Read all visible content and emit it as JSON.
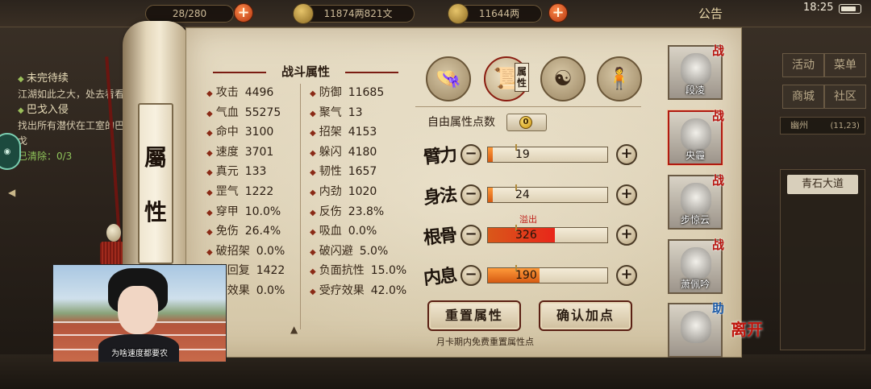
{
  "topbar": {
    "resource1": "28/280",
    "resource2": "11874两821文",
    "resource3": "11644两",
    "notice": "公告",
    "time": "18:25"
  },
  "quest": {
    "items": [
      {
        "title": "未完待续",
        "desc": "江湖如此之大，处去看看"
      },
      {
        "title": "巴戈入侵",
        "desc": "找出所有潜伏在工室的巴戈",
        "progress": "已清除：0/3"
      }
    ]
  },
  "right_menu": {
    "buttons": [
      "活动",
      "菜单",
      "商城",
      "社区"
    ],
    "region": "幽州",
    "region_coords": "(11,23)",
    "location": "青石大道"
  },
  "scroll": {
    "label_top": "屬",
    "label_bottom": "性"
  },
  "stats": {
    "title": "战斗属性",
    "left": [
      {
        "k": "攻击",
        "v": "4496"
      },
      {
        "k": "气血",
        "v": "55275"
      },
      {
        "k": "命中",
        "v": "3100"
      },
      {
        "k": "速度",
        "v": "3701"
      },
      {
        "k": "真元",
        "v": "133"
      },
      {
        "k": "罡气",
        "v": "1222"
      },
      {
        "k": "穿甲",
        "v": "10.0%"
      },
      {
        "k": "免伤",
        "v": "26.4%"
      },
      {
        "k": "破招架",
        "v": "0.0%"
      },
      {
        "k": "血回复",
        "v": "1422"
      },
      {
        "k": "疗效果",
        "v": "0.0%"
      }
    ],
    "right": [
      {
        "k": "防御",
        "v": "11685"
      },
      {
        "k": "聚气",
        "v": "13"
      },
      {
        "k": "招架",
        "v": "4153"
      },
      {
        "k": "躲闪",
        "v": "4180"
      },
      {
        "k": "韧性",
        "v": "1657"
      },
      {
        "k": "内劲",
        "v": "1020"
      },
      {
        "k": "反伤",
        "v": "23.8%"
      },
      {
        "k": "吸血",
        "v": "0.0%"
      },
      {
        "k": "破闪避",
        "v": "5.0%"
      },
      {
        "k": "负面抗性",
        "v": "15.0%"
      },
      {
        "k": "受疗效果",
        "v": "42.0%"
      }
    ]
  },
  "allocation": {
    "tab_label": "属性",
    "free_points_label": "自由属性点数",
    "free_points_value": "0",
    "minus": "−",
    "plus": "+",
    "overflow_label": "溢出",
    "attributes": [
      {
        "name": "臂力",
        "value": "19",
        "fill": 0.02,
        "over": false
      },
      {
        "name": "身法",
        "value": "24",
        "fill": 0.03,
        "over": false
      },
      {
        "name": "根骨",
        "value": "326",
        "fill": 0.56,
        "over": true
      },
      {
        "name": "内息",
        "value": "190",
        "fill": 0.43,
        "over": false
      }
    ],
    "reset_button": "重置属性",
    "confirm_button": "确认加点",
    "footnote": "月卡期内免费重置属性点"
  },
  "party": [
    {
      "name": "段凌",
      "role": "战"
    },
    {
      "name": "央霾",
      "role": "战"
    },
    {
      "name": "步惊云",
      "role": "战"
    },
    {
      "name": "萧佩吟",
      "role": "战"
    },
    {
      "name": "",
      "role": "助"
    }
  ],
  "leave_label": "离开",
  "video": {
    "caption": "为啥速度都要农"
  },
  "colors": {
    "accent_red": "#b8140e",
    "bar_orange": "#e8731f",
    "paper": "#ddd1b6"
  }
}
